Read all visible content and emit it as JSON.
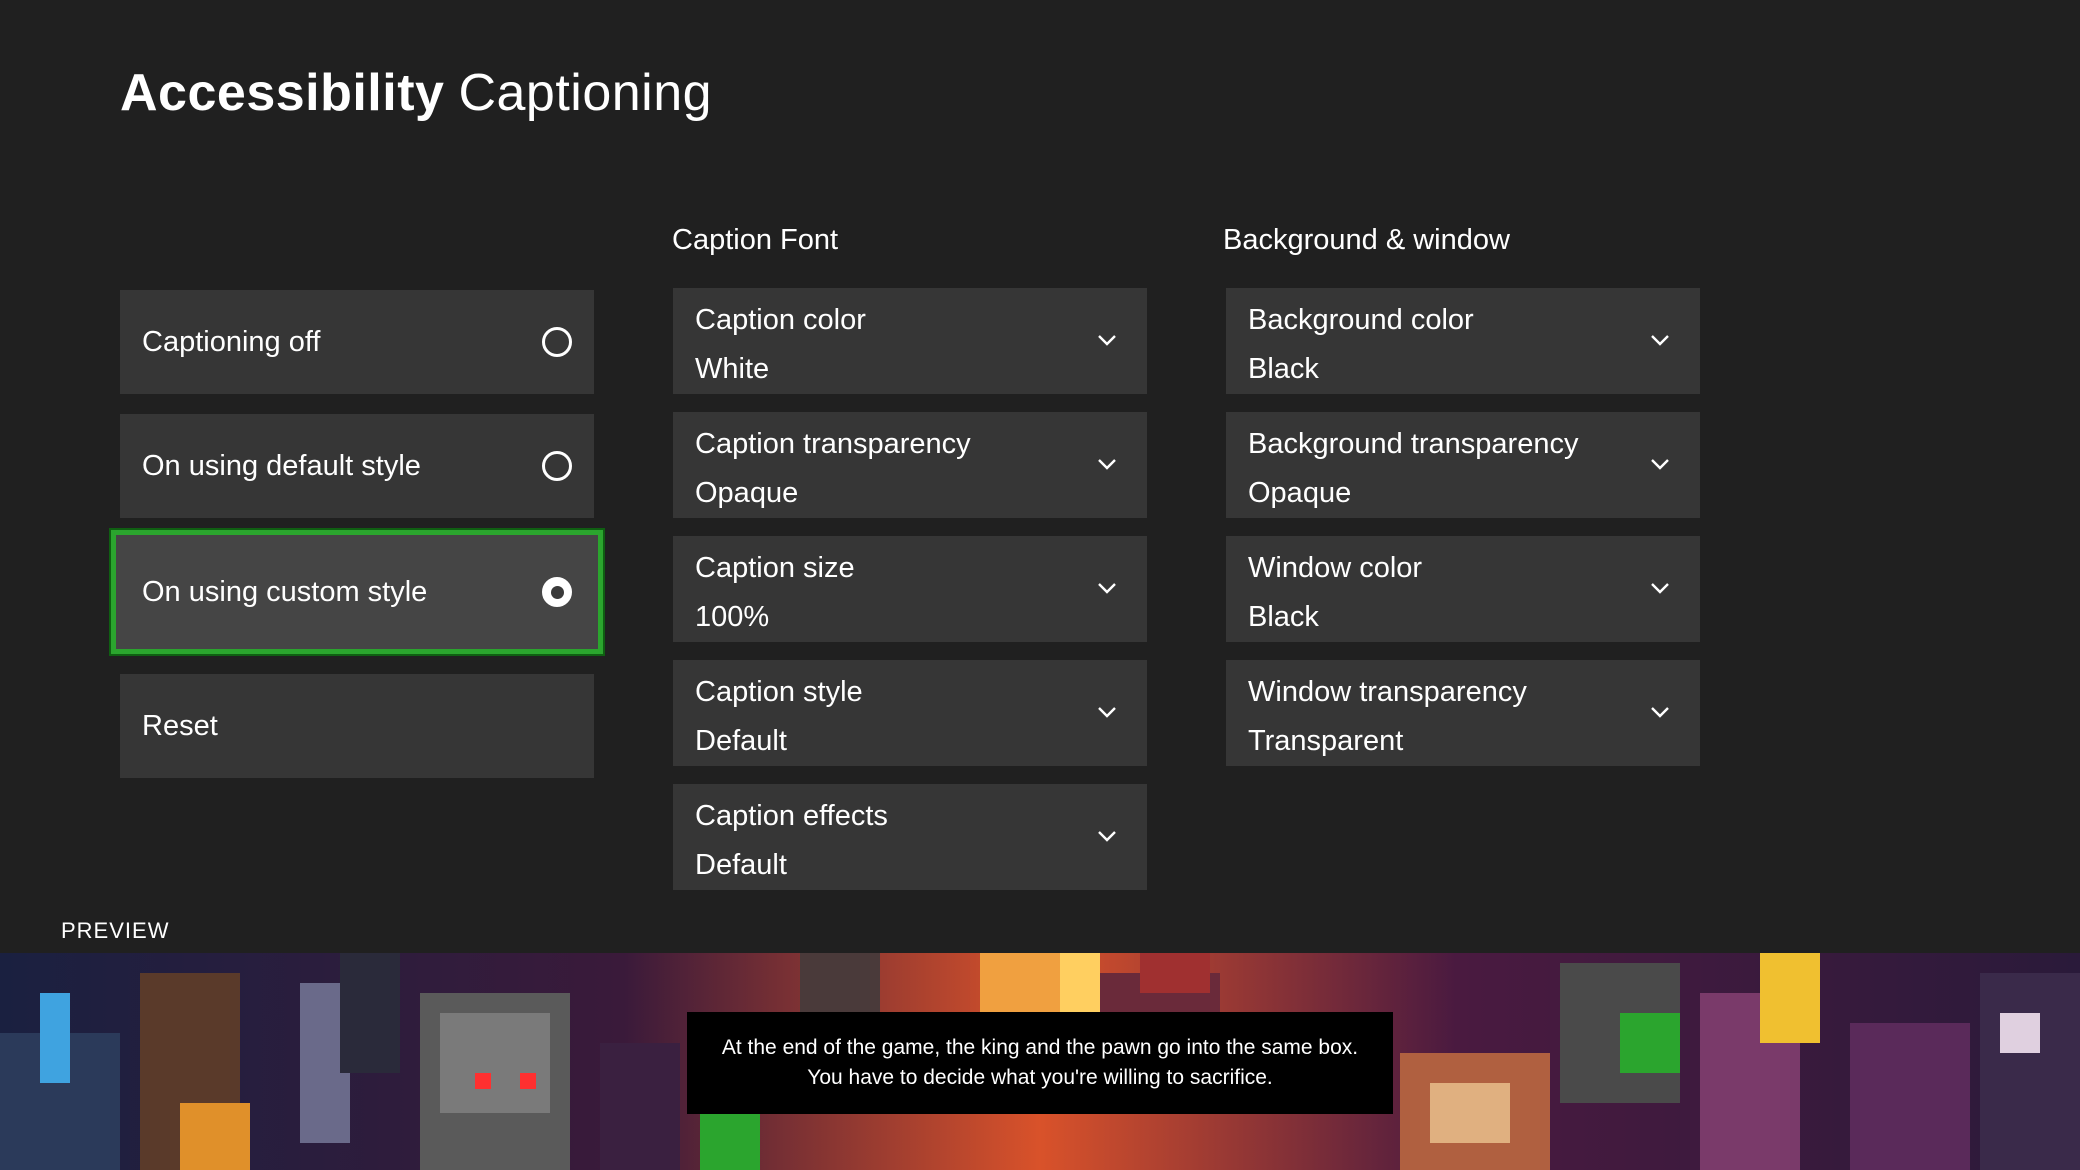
{
  "header": {
    "title_bold": "Accessibility",
    "title_light": "Captioning"
  },
  "captioning": {
    "options": [
      {
        "label": "Captioning off",
        "selected": false
      },
      {
        "label": "On using default style",
        "selected": false
      },
      {
        "label": "On using custom style",
        "selected": true
      }
    ],
    "reset_label": "Reset"
  },
  "caption_font": {
    "heading": "Caption Font",
    "settings": [
      {
        "label": "Caption color",
        "value": "White"
      },
      {
        "label": "Caption transparency",
        "value": "Opaque"
      },
      {
        "label": "Caption size",
        "value": "100%"
      },
      {
        "label": "Caption style",
        "value": "Default"
      },
      {
        "label": "Caption effects",
        "value": "Default"
      }
    ]
  },
  "background_window": {
    "heading": "Background & window",
    "settings": [
      {
        "label": "Background color",
        "value": "Black"
      },
      {
        "label": "Background transparency",
        "value": "Opaque"
      },
      {
        "label": "Window color",
        "value": "Black"
      },
      {
        "label": "Window transparency",
        "value": "Transparent"
      }
    ]
  },
  "preview": {
    "label": "PREVIEW",
    "caption_line1": "At the end of the game, the king and the pawn go into the same box.",
    "caption_line2": "You have to decide what you're willing to sacrifice."
  },
  "colors": {
    "background": "#202020",
    "tile": "#363636",
    "focus_ring": "#2ba52e",
    "text": "#ffffff"
  }
}
